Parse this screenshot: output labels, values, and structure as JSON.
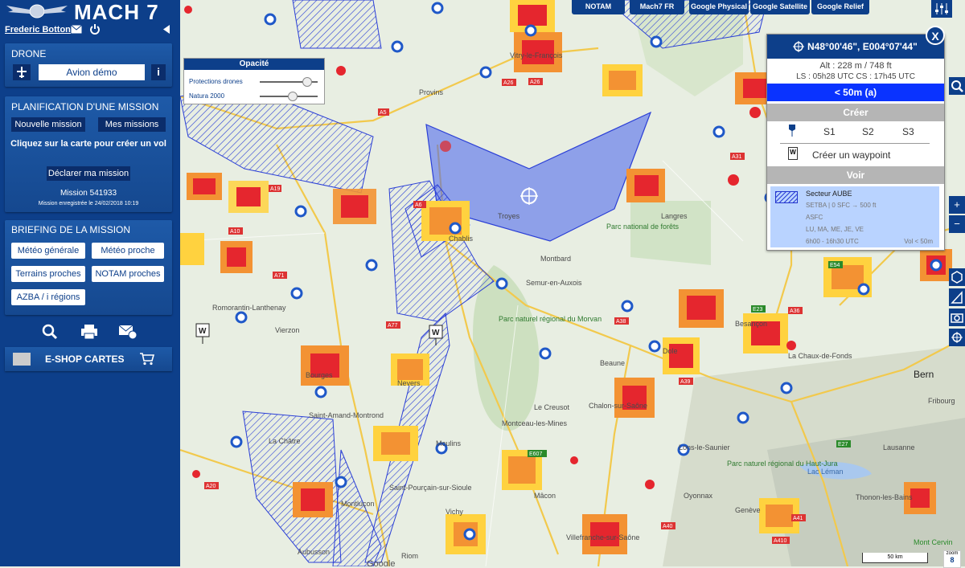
{
  "sidebar": {
    "brand": "MACH 7",
    "user_name": "Frederic Botton",
    "icons": {
      "mail": "mail-icon",
      "power": "power-icon",
      "collapse": "collapse-arrow-icon"
    },
    "drone": {
      "title": "DRONE",
      "aircraft": "Avion démo",
      "info": "i"
    },
    "mission": {
      "title": "PLANIFICATION D'UNE MISSION",
      "new_label": "Nouvelle mission",
      "mine_label": "Mes missions",
      "hint": "Cliquez sur la carte pour créer un vol",
      "declare_label": "Déclarer ma mission",
      "number": "Mission 541933",
      "saved": "Mission enregistrée le 24/02/2018 10:19"
    },
    "briefing": {
      "title": "BRIEFING DE LA MISSION",
      "buttons": [
        "Météo générale",
        "Météo proche",
        "Terrains proches",
        "NOTAM proches",
        "AZBA / i régions"
      ]
    },
    "tools": [
      "search-icon",
      "print-icon",
      "mail-settings-icon"
    ],
    "eshop": "E-SHOP CARTES"
  },
  "top_tabs": [
    "NOTAM",
    "Mach7 FR",
    "Google Physical",
    "Google Satellite",
    "Google Relief"
  ],
  "opacity": {
    "title": "Opacité",
    "sliders": [
      {
        "label": "Protections drones",
        "value": 0.8
      },
      {
        "label": "Natura 2000",
        "value": 0.55
      }
    ]
  },
  "info_panel": {
    "coords": "N48°00'46\", E004°07'44\"",
    "alt": "Alt : 228 m / 748 ft",
    "ls": "LS : 05h28 UTC   CS : 17h45 UTC",
    "restriction": "< 50m (a)",
    "create_title": "Créer",
    "s_labels": [
      "S1",
      "S2",
      "S3"
    ],
    "waypoint_label": "Créer un waypoint",
    "waypoint_icon": "W",
    "view_title": "Voir",
    "sector": {
      "name": "Secteur AUBE",
      "line1": "SETBA | 0 SFC → 500 ft",
      "line2": "ASFC",
      "line3": "LU, MA, ME, JE, VE",
      "line4": "6h00 - 16h30 UTC",
      "vol": "Vol < 50m"
    },
    "close": "X"
  },
  "map": {
    "cities": [
      "Provins",
      "Vitry-le-François",
      "Troyes",
      "Chablis",
      "Montbard",
      "Semur-en-Auxois",
      "Langres",
      "Vierzon",
      "Romorantin-Lanthenay",
      "Bourges",
      "Nevers",
      "Dole",
      "Beaune",
      "Chalon-sur-Saône",
      "Le Creusot",
      "Montceau-les-Mines",
      "Mâcon",
      "Moulins",
      "Vichy",
      "Lons-le-Saunier",
      "Besançon",
      "La Chaux-de-Fonds",
      "Bern",
      "Fribourg",
      "Lausanne",
      "Thonon-les-Bains",
      "Genève",
      "Oyonnax",
      "Riom",
      "Villefranche-sur-Saône",
      "Saint-Amand-Montrond",
      "La Châtre",
      "Montluçon",
      "Saint-Pourçain-sur-Sioule",
      "Aubusson",
      "Mont Cervin",
      "Parc national de forêts",
      "Parc naturel régional du Morvan",
      "Lac Léman",
      "Parc naturel régional du Haut-Jura"
    ],
    "roads": [
      "A5",
      "A19",
      "A26",
      "A31",
      "A6",
      "A71",
      "A77",
      "A20",
      "A36",
      "A38",
      "A39",
      "A40",
      "A41",
      "A410",
      "E27",
      "E23",
      "E54",
      "E607",
      "A10",
      "A26"
    ],
    "waypoint_markers": [
      "W",
      "W"
    ],
    "zoom_label": "zoom",
    "zoom_value": "8",
    "scale": "50 km",
    "google": "Google"
  },
  "colors": {
    "brand_blue": "#0d3f8a",
    "restriction_blue": "#0a33ff",
    "zone_blue": "#2b3fd6",
    "protection_red": "#e5262e",
    "protection_orange": "#f39233",
    "protection_yellow": "#ffd23f"
  }
}
